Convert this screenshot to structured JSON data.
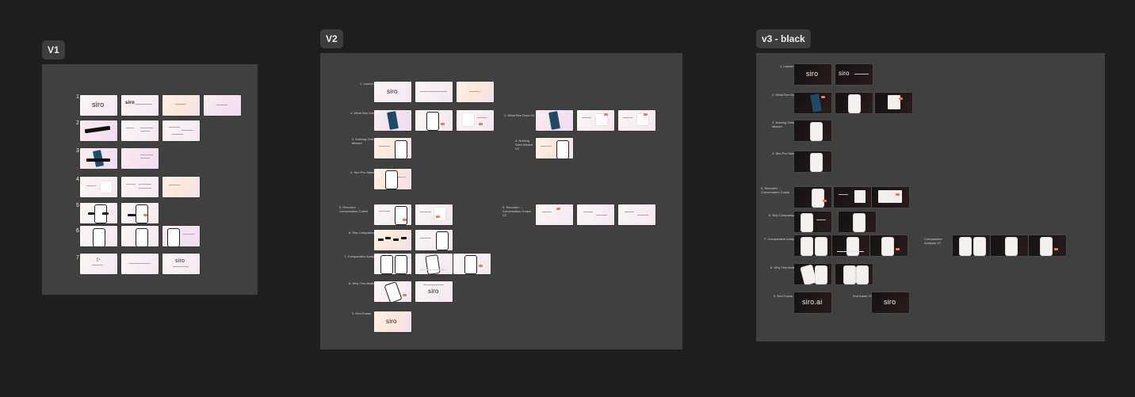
{
  "frames": {
    "v1": {
      "title": "V1",
      "row_numbers": [
        "1",
        "2",
        "3",
        "4",
        "5",
        "6",
        "7"
      ]
    },
    "v2": {
      "title": "V2",
      "row_labels": [
        "1. Launch",
        "2. What Siro Does",
        "3. Nothing Gets Missed",
        "4. Siro Pre-Sales",
        "5. Recorder → Conversation Coach",
        "6. Rep Comparison",
        "7. Comparative Analysis",
        "8. Why This Matters",
        "9. End Frame"
      ],
      "right_labels": [
        "2. What Siro Does V2",
        "3. Nothing Gets Missed V2",
        "5. Recorder → Conversation Coach V2"
      ]
    },
    "v3": {
      "title": "v3 - black",
      "row_labels": [
        "1. Launch",
        "2. What Siro Does",
        "3. Nothing Gets Missed",
        "4. Siro Pre-Sales",
        "5. Recorder → Conversation Coach",
        "6. Rep Comparison",
        "7. Comparative Analysis",
        "8. Why This Matters",
        "9. End Frame"
      ],
      "extra_labels": [
        "Comparative Analysis V2",
        "End frame V2"
      ],
      "end_texts": [
        "siro.ai",
        "siro"
      ]
    }
  },
  "slide_texts": {
    "siro": "siro"
  },
  "colors": {
    "canvas": "#1e1e1e",
    "frame": "#404040",
    "badge": "#3d3d3d",
    "accent": "#f07a4a"
  }
}
